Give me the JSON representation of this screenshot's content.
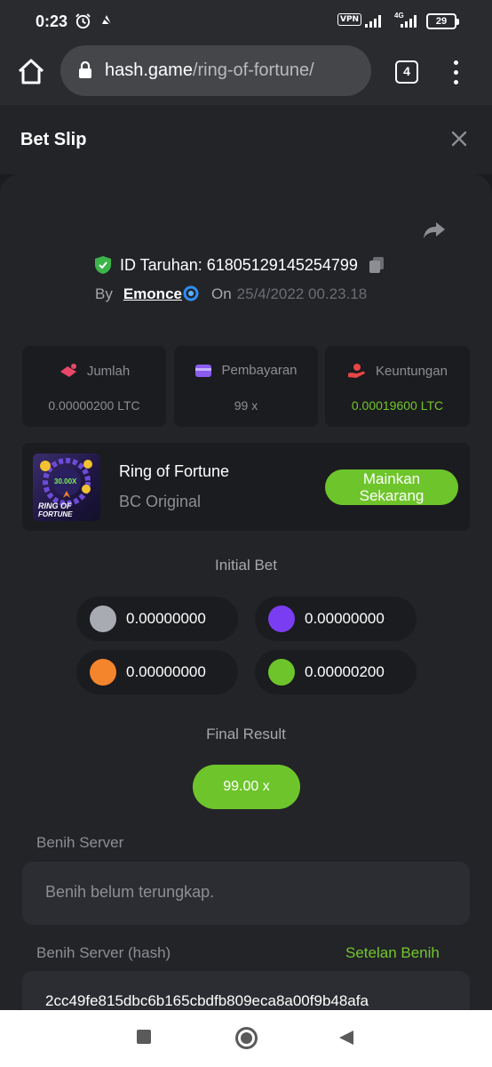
{
  "status_bar": {
    "time": "0:23",
    "vpn_label": "VPN",
    "network": "4G",
    "battery": "29"
  },
  "browser": {
    "url_domain": "hash.game",
    "url_path": "/ring-of-fortune/",
    "tab_count": "4"
  },
  "bet_slip": {
    "title": "Bet Slip",
    "bet_id_label": "ID Taruhan: 61805129145254799",
    "by_label": "By",
    "username": "Emonce",
    "on_label": "On",
    "date": "25/4/2022 00.23.18"
  },
  "stats": [
    {
      "label": "Jumlah",
      "value": "0.00000200 LTC",
      "icon": "amount-icon",
      "color": "#e8476a"
    },
    {
      "label": "Pembayaran",
      "value": "99 x",
      "icon": "payout-icon",
      "color": "#8a5cf0"
    },
    {
      "label": "Keuntungan",
      "value": "0.00019600 LTC",
      "icon": "profit-icon",
      "color": "#e84545"
    }
  ],
  "game": {
    "name": "Ring of Fortune",
    "provider": "BC Original",
    "thumb_multiplier": "30.00X",
    "thumb_title_1": "RING OF",
    "thumb_title_2": "FORTUNE",
    "play_line1": "Mainkan",
    "play_line2": "Sekarang"
  },
  "initial_bet": {
    "label": "Initial Bet",
    "coins": [
      {
        "color": "#a8abb1",
        "amount": "0.00000000"
      },
      {
        "color": "#7b3df2",
        "amount": "0.00000000"
      },
      {
        "color": "#f5852c",
        "amount": "0.00000000"
      },
      {
        "color": "#6ec52b",
        "amount": "0.00000200"
      }
    ]
  },
  "final_result": {
    "label": "Final Result",
    "value": "99.00 x"
  },
  "server_seed": {
    "label": "Benih Server",
    "value": "Benih belum terungkap."
  },
  "server_seed_hash": {
    "label": "Benih Server (hash)",
    "link": "Setelan Benih",
    "value": "2cc49fe815dbc6b165cbdfb809eca8a00f9b48afa"
  },
  "colors": {
    "accent_green": "#6ec52b",
    "background": "#1b1c1f",
    "panel": "#232428"
  }
}
